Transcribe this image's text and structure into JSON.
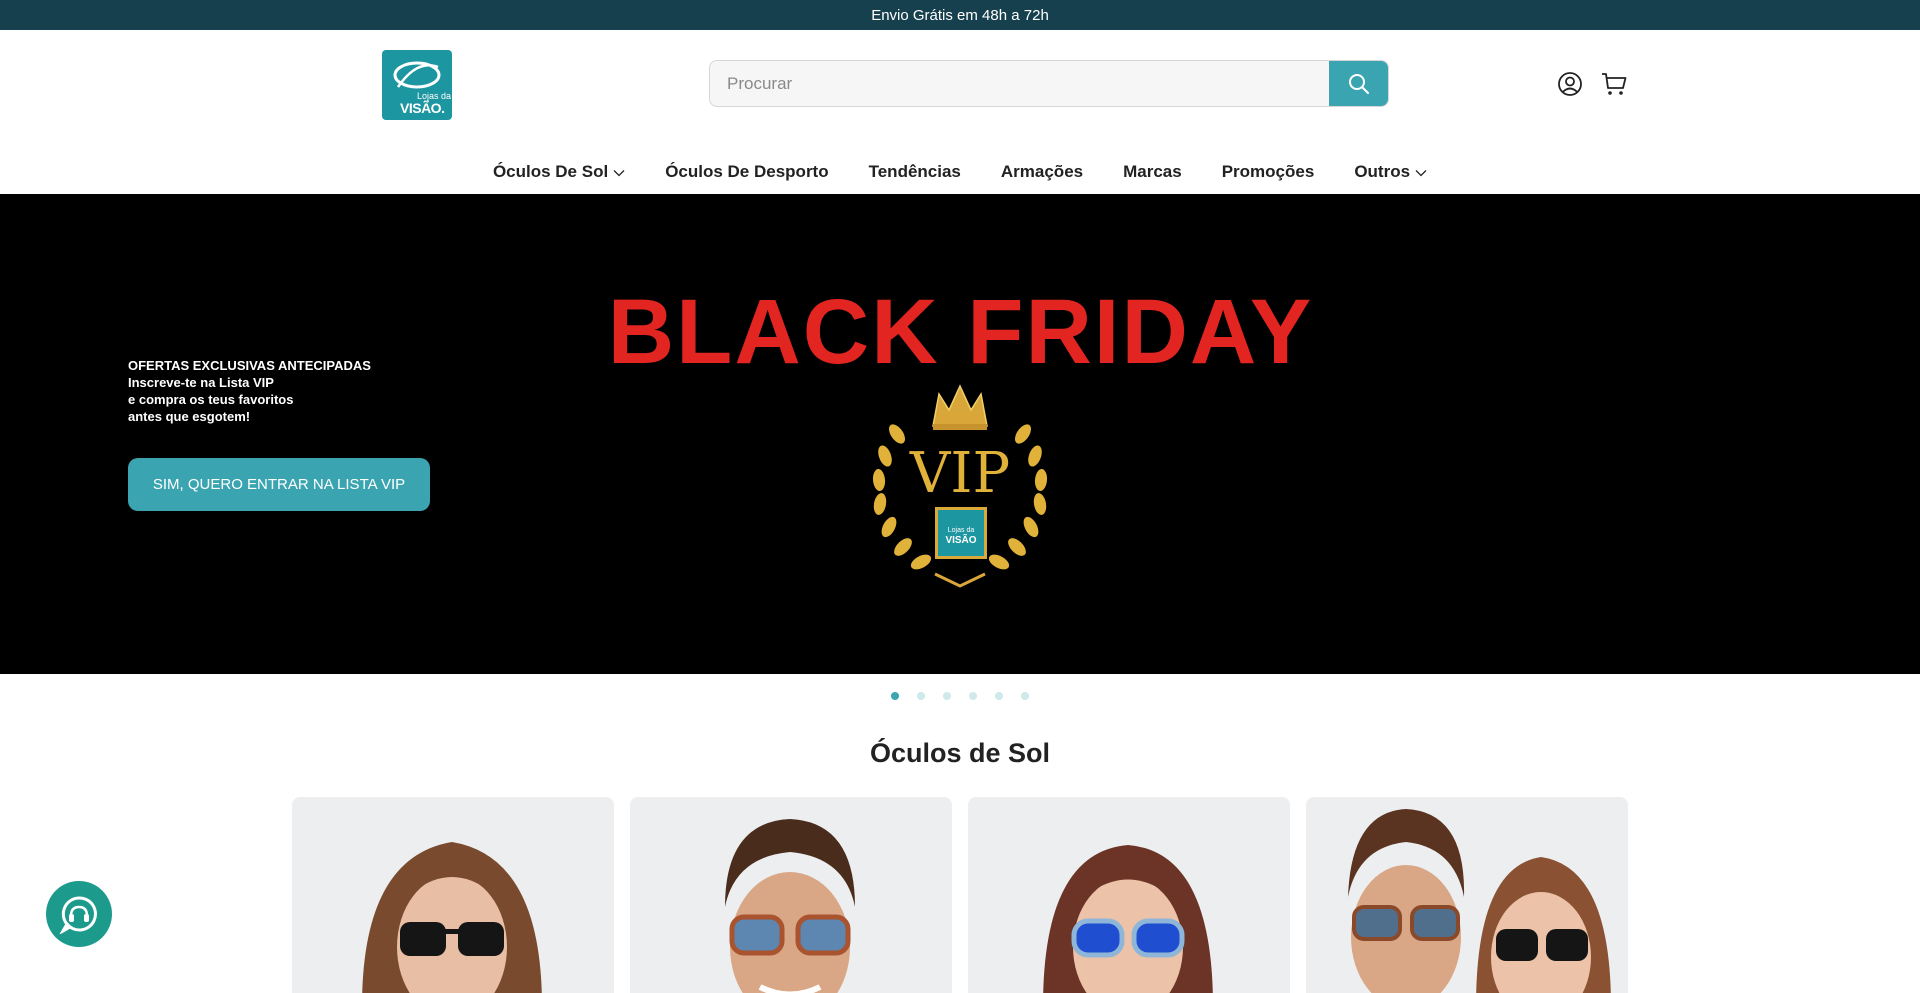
{
  "announcement": {
    "text": "Envio Grátis em 48h a 72h"
  },
  "header": {
    "logo": {
      "line1": "Lojas da",
      "line2": "VISÃO."
    },
    "search": {
      "placeholder": "Procurar",
      "value": ""
    },
    "icons": {
      "search": "search-icon",
      "account": "account-icon",
      "cart": "cart-icon"
    }
  },
  "nav": {
    "items": [
      {
        "label": "Óculos De Sol",
        "has_dropdown": true
      },
      {
        "label": "Óculos De Desporto",
        "has_dropdown": false
      },
      {
        "label": "Tendências",
        "has_dropdown": false
      },
      {
        "label": "Armações",
        "has_dropdown": false
      },
      {
        "label": "Marcas",
        "has_dropdown": false
      },
      {
        "label": "Promoções",
        "has_dropdown": false
      },
      {
        "label": "Outros",
        "has_dropdown": true
      }
    ]
  },
  "hero": {
    "eyebrow": "OFERTAS EXCLUSIVAS ANTECIPADAS",
    "line2": "Inscreve-te na Lista VIP",
    "line3": "e compra os teus favoritos",
    "line4": "antes que esgotem!",
    "button_label": "SIM, QUERO ENTRAR NA LISTA VIP",
    "banner_title": "BLACK FRIDAY",
    "badge_text": "VIP",
    "badge_logo": {
      "line1": "Lojas da",
      "line2": "VISÃO"
    }
  },
  "carousel": {
    "slide_count": 6,
    "active_index": 0
  },
  "section": {
    "title": "Óculos de Sol"
  },
  "products": [
    {
      "image": "woman-black-sunglasses"
    },
    {
      "image": "man-blue-lens-sunglasses"
    },
    {
      "image": "girl-blue-sunglasses"
    },
    {
      "image": "couple-sunglasses"
    }
  ],
  "colors": {
    "announcement_bg": "#16404d",
    "accent": "#3aa5b0",
    "brand": "#1c96a0",
    "banner_red": "#e32521",
    "gold": "#e0b23a",
    "whatsapp": "#1c9a8c"
  },
  "floating": {
    "whatsapp": "whatsapp-icon"
  }
}
